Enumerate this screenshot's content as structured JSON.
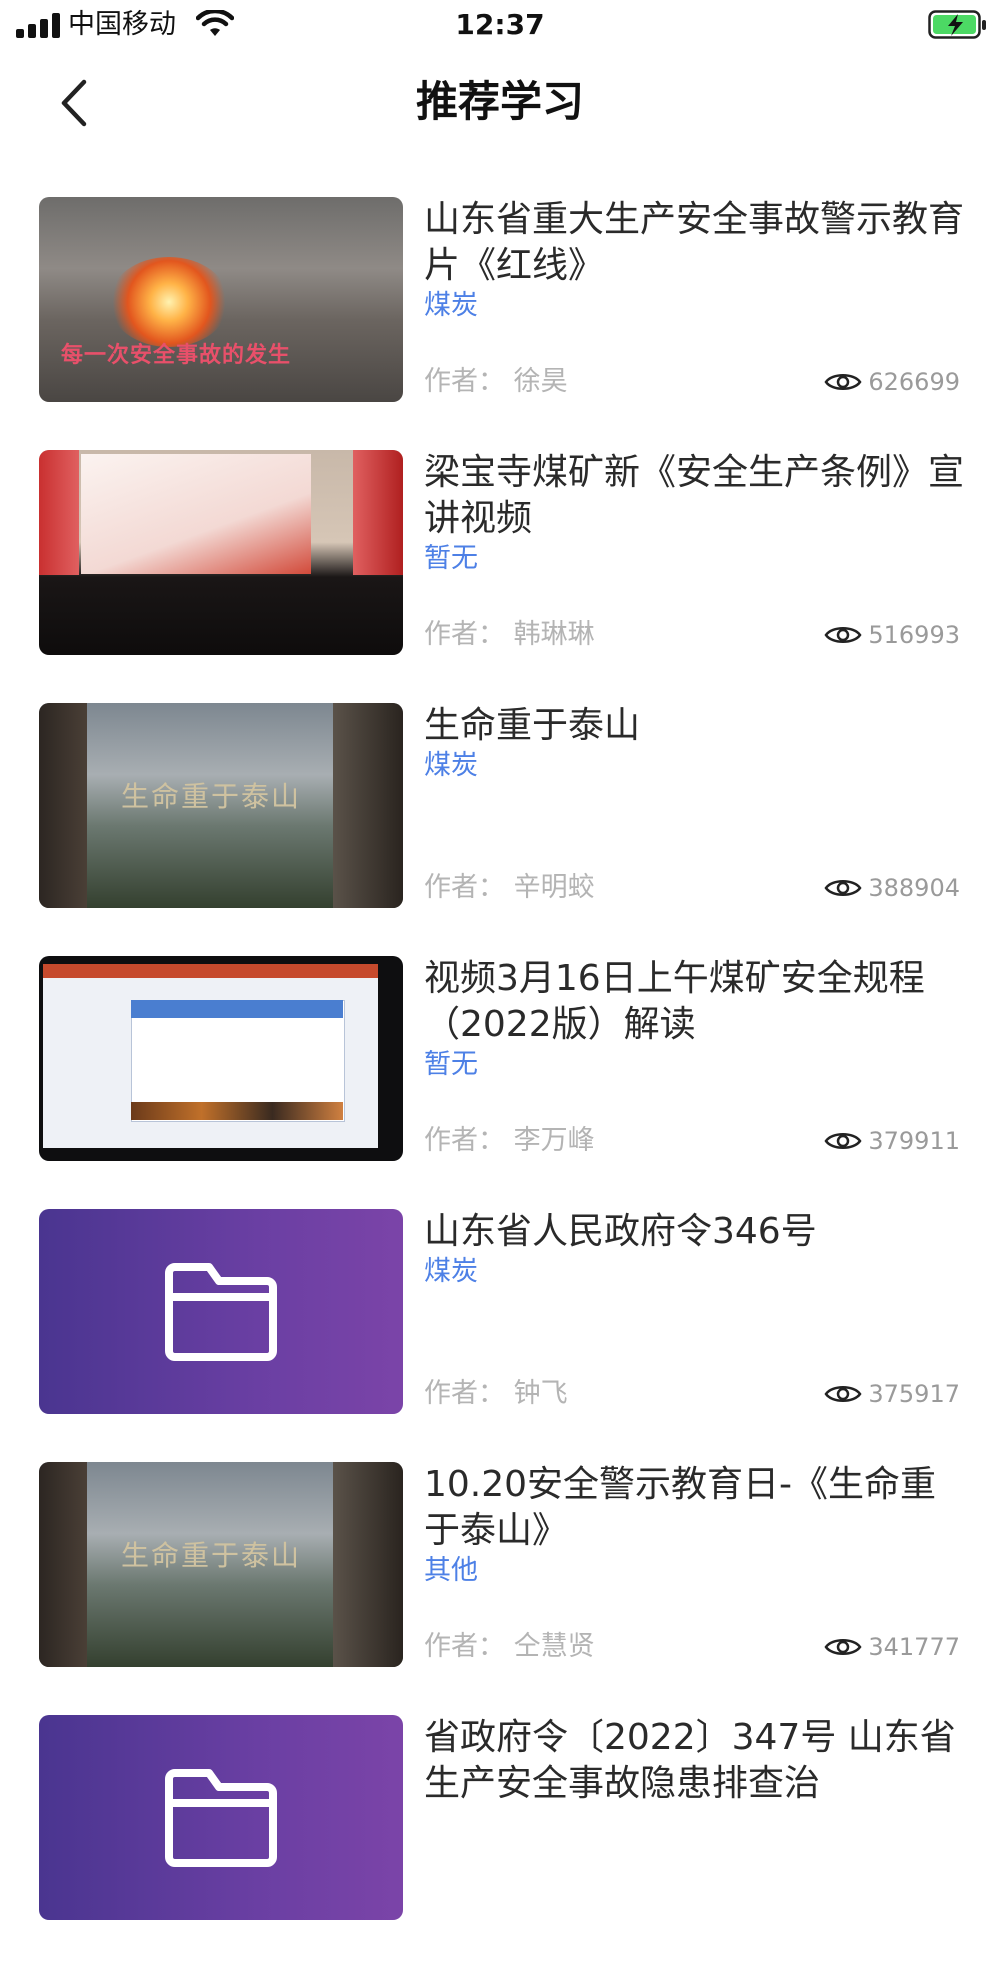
{
  "status_bar": {
    "carrier": "中国移动",
    "time": "12:37"
  },
  "nav": {
    "title": "推荐学习",
    "back_icon": "chevron-left-icon"
  },
  "videos": [
    {
      "title": "山东省重大生产安全事故警示教育片《红线》",
      "category": "煤炭",
      "author": "作者：  徐昊",
      "views": "626699",
      "thumbnail": "fire-accident-thumbnail",
      "thumbnail_caption": "每一次安全事故的发生"
    },
    {
      "title": "梁宝寺煤矿新《安全生产条例》宣讲视频",
      "category": "暂无",
      "author": "作者：  韩琳琳",
      "views": "516993",
      "thumbnail": "lecture-hall-thumbnail"
    },
    {
      "title": "生命重于泰山",
      "category": "煤炭",
      "author": "作者：  辛明蛟",
      "views": "388904",
      "thumbnail": "mountain-calligraphy-thumbnail",
      "thumbnail_caption": "生命重于泰山"
    },
    {
      "title": "视频3月16日上午煤矿安全规程（2022版）解读",
      "category": "暂无",
      "author": "作者：  李万峰",
      "views": "379911",
      "thumbnail": "slides-screenshot-thumbnail"
    },
    {
      "title": "山东省人民政府令346号",
      "category": "煤炭",
      "author": "作者：  钟飞",
      "views": "375917",
      "thumbnail": "folder-icon"
    },
    {
      "title": "10.20安全警示教育日-《生命重于泰山》",
      "category": "其他",
      "author": "作者：  仝慧贤",
      "views": "341777",
      "thumbnail": "mountain-calligraphy-thumbnail",
      "thumbnail_caption": "生命重于泰山"
    },
    {
      "title": "省政府令〔2022〕347号 山东省生产安全事故隐患排查治",
      "thumbnail": "folder-icon"
    }
  ],
  "colors": {
    "category": "#4d80e6",
    "author": "#b4b4b4",
    "folder_gradient_start": "#4a3590",
    "folder_gradient_end": "#7b44a8"
  }
}
